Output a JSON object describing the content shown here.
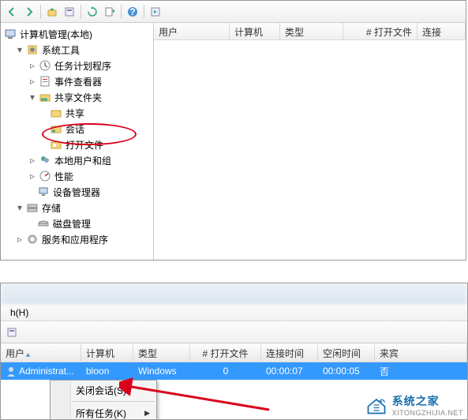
{
  "top": {
    "root": "计算机管理(本地)",
    "sys_tools": "系统工具",
    "task_scheduler": "任务计划程序",
    "event_viewer": "事件查看器",
    "shared_folders": "共享文件夹",
    "shares": "共享",
    "sessions": "会话",
    "open_files": "打开文件",
    "local_users": "本地用户和组",
    "performance": "性能",
    "device_manager": "设备管理器",
    "storage": "存储",
    "disk_mgmt": "磁盘管理",
    "services_apps": "服务和应用程序",
    "cols": {
      "user": "用户",
      "computer": "计算机",
      "type": "类型",
      "open_files": "# 打开文件",
      "connect": "连接"
    }
  },
  "bottom": {
    "help_menu": "h(H)",
    "cols": {
      "user": "用户",
      "computer": "计算机",
      "type": "类型",
      "open_files": "# 打开文件",
      "connect_time": "连接时间",
      "idle_time": "空闲时间",
      "guest": "来宾"
    },
    "row": {
      "user": "Administrat...",
      "computer": "bloon",
      "type": "Windows",
      "open_files": "0",
      "connect_time": "00:00:07",
      "idle_time": "00:00:05",
      "guest": "否"
    },
    "menu": {
      "close_session": "关闭会话(S)",
      "all_tasks": "所有任务(K)"
    }
  },
  "watermark": {
    "title": "系统之家",
    "url": "XITONGZHIJIA.NET"
  }
}
